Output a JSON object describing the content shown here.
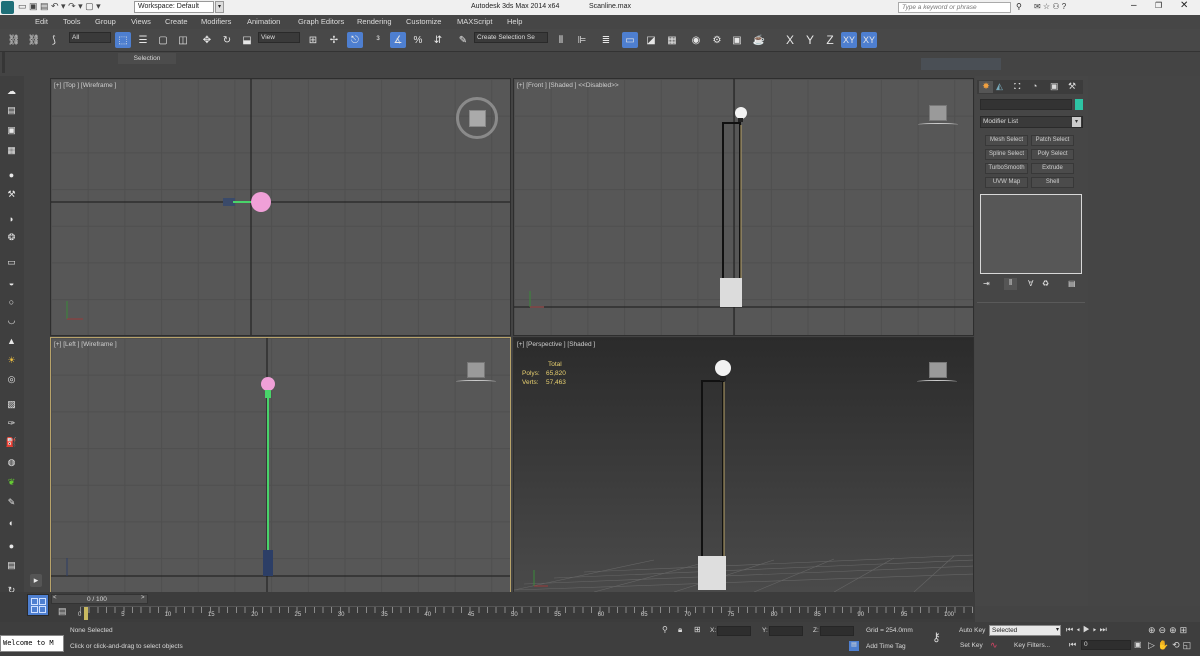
{
  "title_bar": {
    "workspace": "Workspace: Default",
    "app_title": "Autodesk 3ds Max  2014 x64",
    "file_name": "Scanline.max",
    "search_placeholder": "Type a keyword or phrase"
  },
  "menu": [
    "Edit",
    "Tools",
    "Group",
    "Views",
    "Create",
    "Modifiers",
    "Animation",
    "Graph Editors",
    "Rendering",
    "Customize",
    "MAXScript",
    "Help"
  ],
  "toolbar": {
    "filter": "All",
    "ref_coord": "View",
    "selection_set": "Create Selection Se",
    "axes": [
      "X",
      "Y",
      "Z",
      "XY",
      "XY"
    ]
  },
  "ribbon": {
    "selection_label": "Selection"
  },
  "viewports": {
    "top_label": "[+] [Top ] [Wireframe ]",
    "front_label": "[+] [Front ] [Shaded ]  <<Disabled>>",
    "left_label": "[+] [Left ] [Wireframe ]",
    "persp_label": "[+] [Perspective ] [Shaded ]",
    "stats": {
      "total": "Total",
      "polys_label": "Polys:",
      "polys": "65,820",
      "verts_label": "Verts:",
      "verts": "57,463"
    }
  },
  "command_panel": {
    "modifier_list": "Modifier List",
    "buttons": [
      "Mesh Select",
      "Patch Select",
      "Spline Select",
      "Poly Select",
      "TurboSmooth",
      "Extrude",
      "UVW Map",
      "Shell"
    ],
    "color_swatch": "#2ec4a4"
  },
  "timeline": {
    "frame": "0 / 100",
    "ticks": [
      "0",
      "5",
      "10",
      "15",
      "20",
      "25",
      "30",
      "35",
      "40",
      "45",
      "50",
      "55",
      "60",
      "65",
      "70",
      "75",
      "80",
      "85",
      "90",
      "95",
      "100"
    ]
  },
  "status": {
    "maxscript": "Welcome to M",
    "selection": "None Selected",
    "prompt": "Click or click-and-drag to select objects",
    "x_label": "X:",
    "y_label": "Y:",
    "z_label": "Z:",
    "grid": "Grid = 254.0mm",
    "add_time_tag": "Add Time Tag",
    "auto_key": "Auto Key",
    "auto_key_value": "Selected",
    "set_key": "Set Key",
    "key_filters": "Key Filters...",
    "current_frame": "0"
  },
  "colors": {
    "accent_blue": "#4e7fd0",
    "helper_pink": "#f0a0d8",
    "helper_green": "#49d46a",
    "active_border": "#b8a36a"
  }
}
